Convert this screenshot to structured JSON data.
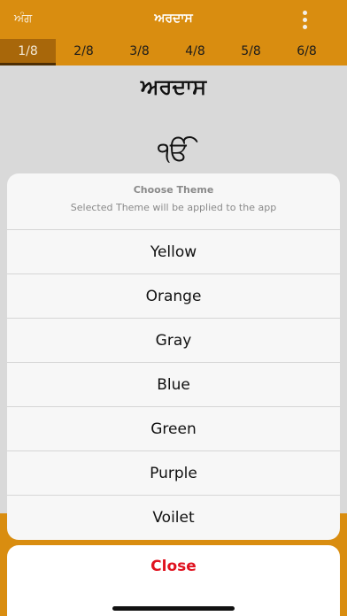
{
  "topbar": {
    "left_label": "ਅੰਗ",
    "title": "ਅਰਦਾਸ",
    "menu_icon": "more-vertical-icon"
  },
  "tabs": [
    {
      "label": "1/8",
      "active": true
    },
    {
      "label": "2/8"
    },
    {
      "label": "3/8"
    },
    {
      "label": "4/8"
    },
    {
      "label": "5/8"
    },
    {
      "label": "6/8"
    }
  ],
  "content": {
    "heading": "ਅਰਦਾਸ",
    "ek_onkar": "ੴ"
  },
  "sheet": {
    "title": "Choose Theme",
    "subtitle": "Selected Theme will be applied to the app",
    "options": [
      "Yellow",
      "Orange",
      "Gray",
      "Blue",
      "Green",
      "Purple",
      "Voilet"
    ],
    "cancel_label": "Close"
  },
  "colors": {
    "accent": "#d98d10",
    "active_tab": "#a8670a",
    "destructive": "#e0121f"
  }
}
